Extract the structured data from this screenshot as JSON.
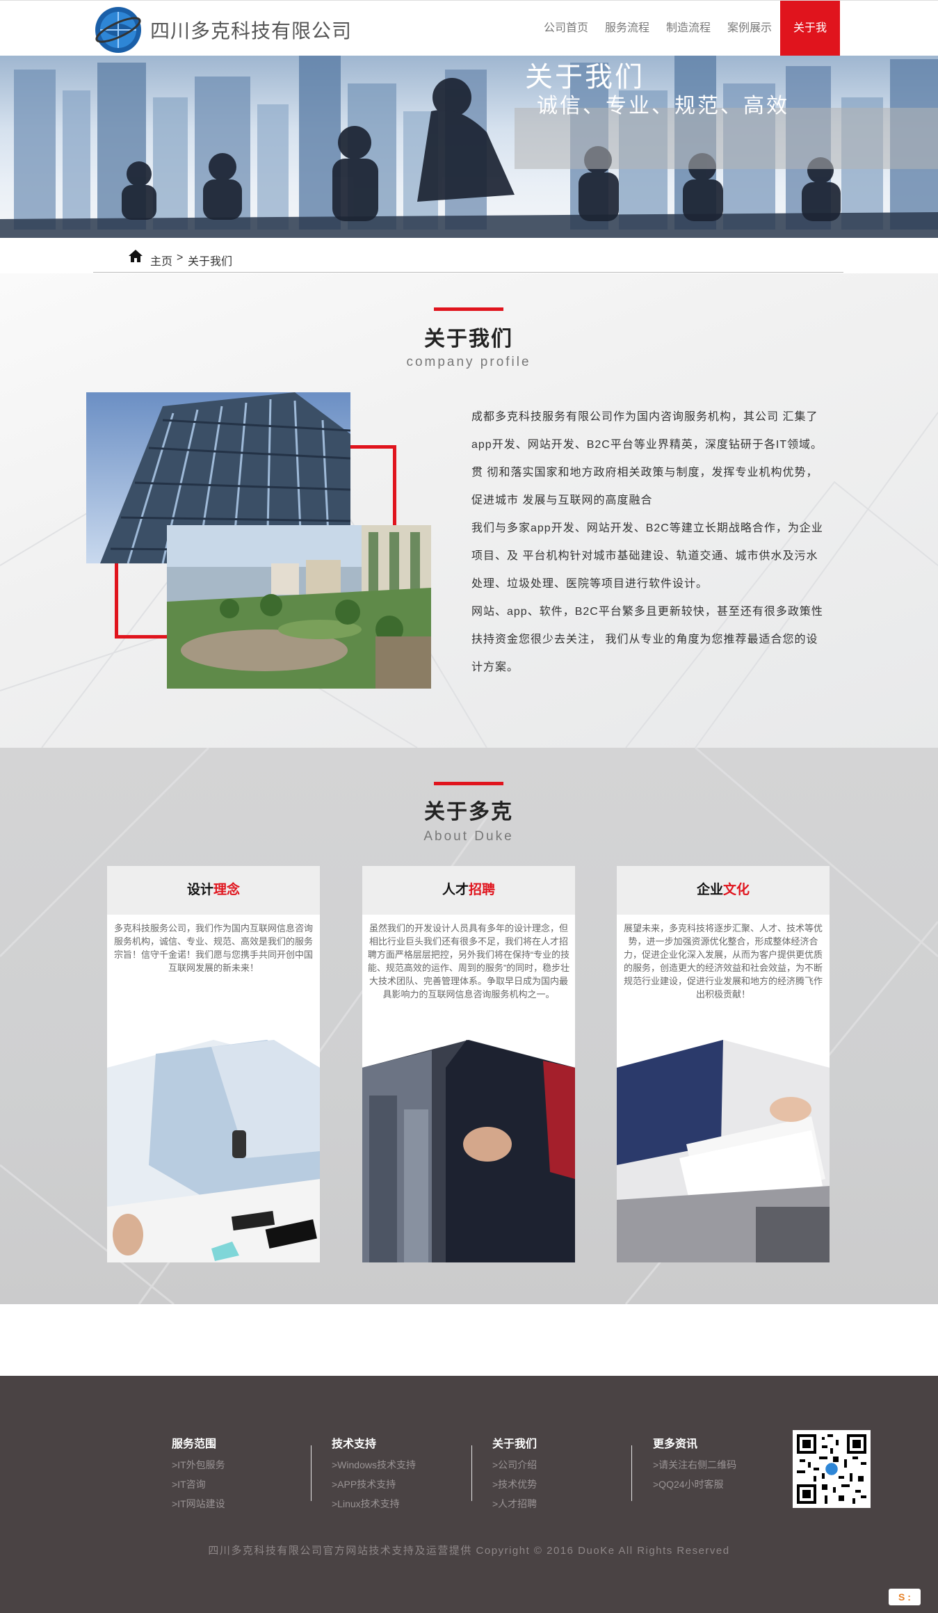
{
  "header": {
    "company_name": "四川多克科技有限公司",
    "nav": [
      {
        "label": "公司首页",
        "active": false
      },
      {
        "label": "服务流程",
        "active": false
      },
      {
        "label": "制造流程",
        "active": false
      },
      {
        "label": "案例展示",
        "active": false
      },
      {
        "label": "关于我们",
        "active": true
      }
    ],
    "accent_color": "#e0141d"
  },
  "banner": {
    "title": "关于我们",
    "subtitle": "诚信、专业、规范、高效"
  },
  "breadcrumb": {
    "home": "主页",
    "separator": ">",
    "current": "关于我们"
  },
  "profile": {
    "title": "关于我们",
    "subtitle": "company profile",
    "paragraphs": [
      "成都多克科技服务有限公司作为国内咨询服务机构，其公司 汇集了app开发、网站开发、B2C平台等业界精英，深度钻研于各IT领域。贯 彻和落实国家和地方政府相关政策与制度，发挥专业机构优势，促进城市 发展与互联网的高度融合",
      "我们与多家app开发、网站开发、B2C等建立长期战略合作，为企业项目、及 平台机构针对城市基础建设、轨道交通、城市供水及污水 处理、垃圾处理、医院等项目进行软件设计。",
      "网站、app、软件，B2C平台繁多且更新较快，甚至还有很多政策性扶持资金您很少去关注， 我们从专业的角度为您推荐最适合您的设计方案。"
    ]
  },
  "about": {
    "title": "关于多克",
    "subtitle": "About Duke",
    "cards": [
      {
        "title_black": "设计",
        "title_red": "理念",
        "text": "多克科技服务公司，我们作为国内互联网信息咨询服务机构，诚信、专业、规范、高效是我们的服务宗旨！信守千金诺！我们愿与您携手共同开创中国互联网发展的新未来！"
      },
      {
        "title_black": "人才",
        "title_red": "招聘",
        "text": "虽然我们的开发设计人员具有多年的设计理念，但相比行业巨头我们还有很多不足，我们将在人才招聘方面严格层层把控，另外我们将在保持“专业的技能、规范高效的运作、周到的服务”的同时，稳步壮大技术团队、完善管理体系。争取早日成为国内最具影响力的互联网信息咨询服务机构之一。"
      },
      {
        "title_black": "企业",
        "title_red": "文化",
        "text": "展望未来，多克科技将逐步汇聚、人才、技术等优势，进一步加强资源优化整合，形成整体经济合力，促进企业化深入发展，从而为客户提供更优质的服务，创造更大的经济效益和社会效益，为不断规范行业建设，促进行业发展和地方的经济腾飞作出积极贡献！"
      }
    ]
  },
  "footer": {
    "columns": [
      {
        "title": "服务范围",
        "links": [
          ">IT外包服务",
          ">IT咨询",
          ">IT网站建设"
        ]
      },
      {
        "title": "技术支持",
        "links": [
          ">Windows技术支持",
          ">APP技术支持",
          ">Linux技术支持"
        ]
      },
      {
        "title": "关于我们",
        "links": [
          ">公司介绍",
          ">技术优势",
          ">人才招聘"
        ]
      },
      {
        "title": "更多资讯",
        "links": [
          ">请关注右侧二维码",
          ">QQ24小时客服"
        ]
      }
    ],
    "copyright": "四川多克科技有限公司官方网站技术支持及运营提供 Copyright © 2016 DuoKe All Rights Reserved",
    "badge": "S :"
  }
}
